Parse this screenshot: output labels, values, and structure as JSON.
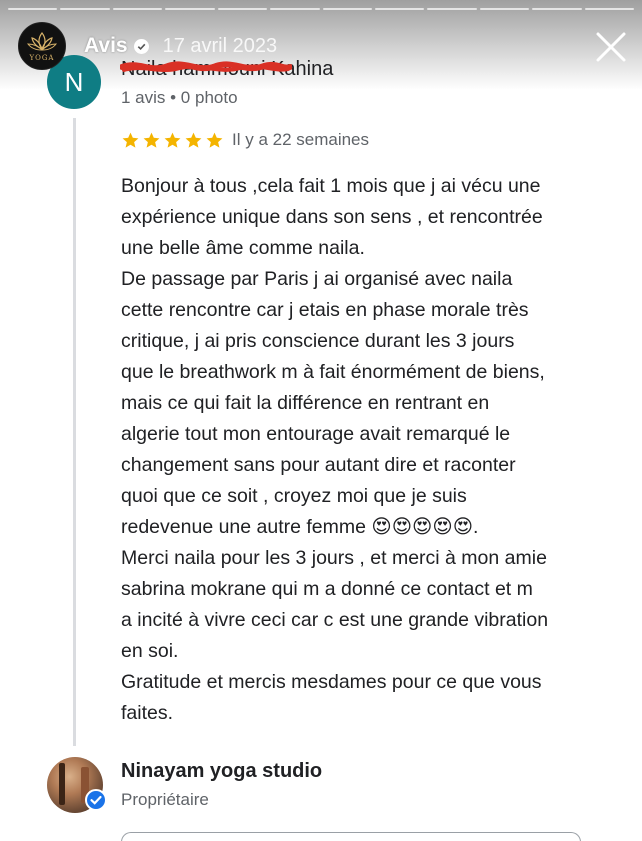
{
  "story": {
    "account_name": "Avis",
    "date": "17 avril 2023",
    "avatar_text": "YOGA",
    "progress_segments": 12
  },
  "review": {
    "avatar_letter": "N",
    "reviewer_name": "Naila hammouni Kahina",
    "meta": "1 avis • 0 photo",
    "rating": 5,
    "time_ago": "Il y a 22 semaines",
    "body_lines": [
      "Bonjour à tous ,cela fait 1 mois que j ai vécu une",
      "expérience unique dans son sens , et rencontrée",
      "une belle âme comme naila.",
      "De passage par Paris j ai organisé avec naila",
      "cette rencontre car j etais en phase morale très",
      "critique, j ai pris conscience durant les 3 jours",
      "que le breathwork m à fait énormément de biens,",
      "mais ce qui fait la différence en rentrant en",
      "algerie tout mon entourage avait remarqué le",
      "changement sans pour autant dire et raconter",
      "quoi que ce soit , croyez moi que je suis",
      "redevenue une autre femme 😍😍😍😍😍.",
      "Merci naila pour les 3 jours , et merci à mon amie",
      "sabrina mokrane qui m a donné ce contact et m",
      "a incité à vivre ceci car c est une grande vibration",
      "en soi.",
      "Gratitude et mercis mesdames pour ce que vous",
      "faites."
    ]
  },
  "owner": {
    "name": "Ninayam yoga studio",
    "role": "Propriétaire"
  },
  "colors": {
    "reviewer_avatar_bg": "#0f7d84",
    "star": "#f4b400",
    "verified": "#1a73e8",
    "scribble": "#d93025"
  }
}
